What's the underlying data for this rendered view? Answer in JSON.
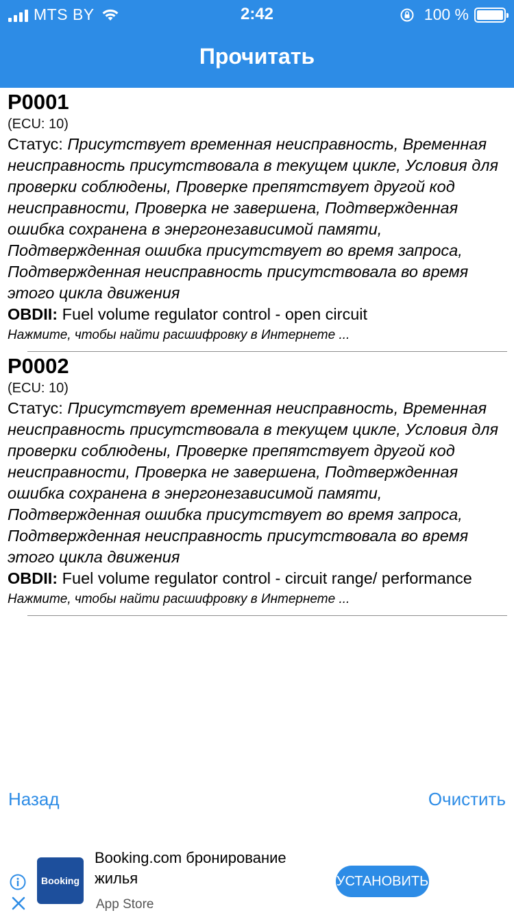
{
  "statusbar": {
    "carrier": "MTS BY",
    "time": "2:42",
    "battery": "100 %"
  },
  "nav": {
    "title": "Прочитать"
  },
  "entries": [
    {
      "code": "P0001",
      "ecu": "(ECU: 10)",
      "status_label": "Статус: ",
      "status_text": "Присутствует временная неисправность, Временная неисправность присутствовала в текущем цикле, Условия для проверки соблюдены, Проверке препятствует другой код неисправности, Проверка не завершена, Подтвержденная ошибка сохранена в энергонезависимой памяти, Подтвержденная ошибка присутствует во время запроса, Подтвержденная неисправность присутствовала во время этого цикла движения",
      "obd_label": "OBDII:",
      "obd_text": " Fuel volume regulator control - open circuit",
      "hint": "Нажмите, чтобы найти расшифровку в Интернете ..."
    },
    {
      "code": "P0002",
      "ecu": "(ECU: 10)",
      "status_label": "Статус: ",
      "status_text": "Присутствует временная неисправность, Временная неисправность присутствовала в текущем цикле, Условия для проверки соблюдены, Проверке препятствует другой код неисправности, Проверка не завершена, Подтвержденная ошибка сохранена в энергонезависимой памяти, Подтвержденная ошибка присутствует во время запроса, Подтвержденная неисправность присутствовала во время этого цикла движения",
      "obd_label": "OBDII:",
      "obd_text": " Fuel volume regulator control - circuit range/ performance",
      "hint": "Нажмите, чтобы найти расшифровку в Интернете ..."
    }
  ],
  "buttons": {
    "back": "Назад",
    "clear": "Очистить"
  },
  "ad": {
    "logo_text": "Booking",
    "title": "Booking.com бронирование жилья",
    "store": "App Store",
    "install": "УСТАНОВИТЬ"
  },
  "colors": {
    "accent": "#2D8CE6",
    "logo_bg": "#1d4f9c"
  }
}
